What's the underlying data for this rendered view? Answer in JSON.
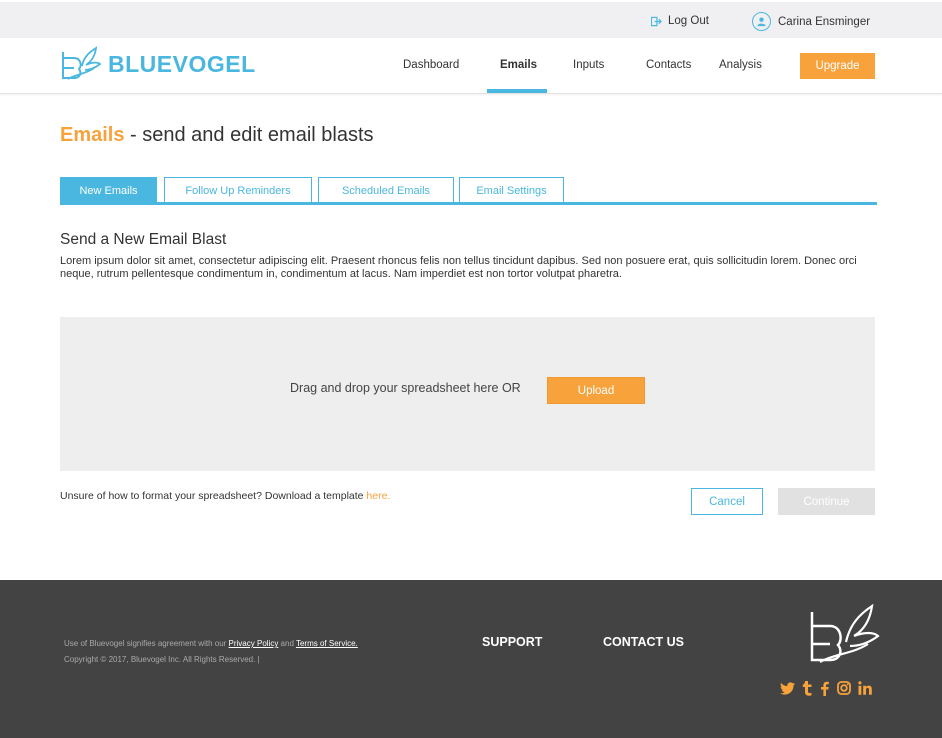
{
  "topbar": {
    "logout_label": "Log Out",
    "user_name": "Carina Ensminger"
  },
  "header": {
    "brand": "BLUEVOGEL",
    "nav": [
      {
        "label": "Dashboard"
      },
      {
        "label": "Emails"
      },
      {
        "label": "Inputs"
      },
      {
        "label": "Contacts"
      },
      {
        "label": "Analysis"
      }
    ],
    "active_nav": "Emails",
    "upgrade_label": "Upgrade"
  },
  "page": {
    "title_accent": "Emails",
    "title_rest": " - send and edit email blasts"
  },
  "tabs": [
    {
      "label": "New Emails"
    },
    {
      "label": "Follow Up Reminders"
    },
    {
      "label": "Scheduled Emails"
    },
    {
      "label": "Email Settings"
    }
  ],
  "active_tab": "New Emails",
  "section": {
    "title": "Send a New Email Blast",
    "body": "Lorem ipsum dolor sit amet, consectetur adipiscing elit. Praesent rhoncus felis non tellus tincidunt dapibus. Sed non posuere erat, quis sollicitudin lorem. Donec orci neque, rutrum pellentesque condimentum in, condimentum at lacus. Nam imperdiet est non tortor volutpat pharetra."
  },
  "dropzone": {
    "text": "Drag and drop your spreadsheet here OR",
    "upload_label": "Upload"
  },
  "template_hint": {
    "text": "Unsure of how to format your spreadsheet? Download a template ",
    "link": "here."
  },
  "actions": {
    "cancel_label": "Cancel",
    "continue_label": "Continue"
  },
  "footer": {
    "legal_prefix": "Use of Bluevogel signifies agreement with our ",
    "privacy_label": "Privacy Policy",
    "legal_and": " and ",
    "terms_label": "Terms of Service.",
    "copyright": "Copyright © 2017, Bluevogel Inc. All Rights Reserved. |",
    "support_label": "SUPPORT",
    "contact_label": "CONTACT US",
    "social": [
      "twitter-icon",
      "tumblr-icon",
      "facebook-icon",
      "instagram-icon",
      "linkedin-icon"
    ]
  },
  "colors": {
    "brand_blue": "#4ab7e0",
    "accent_orange": "#f7a23b",
    "footer_bg": "#434343"
  }
}
